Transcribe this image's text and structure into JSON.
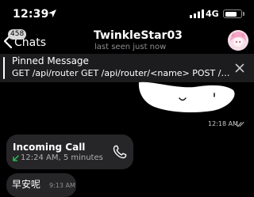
{
  "status_bar": {
    "time": "12:39",
    "network": "4G",
    "icons": [
      "location-arrow-icon",
      "cellular-signal-icon",
      "battery-icon"
    ]
  },
  "header": {
    "back_label": "Chats",
    "unread_badge": "458",
    "title": "TwinkleStar03",
    "subtitle": "last seen just now"
  },
  "pinned": {
    "title": "Pinned Message",
    "text": "GET /api/router GET /api/router/<name> POST /api/r..."
  },
  "messages": {
    "sticker_time": "12:18 AM",
    "call": {
      "title": "Incoming Call",
      "detail": "12:24 AM, 5 minutes"
    },
    "last": {
      "text": "早安呢",
      "time": "9:13 AM"
    }
  },
  "colors": {
    "background": "#000000",
    "bubble": "#262628",
    "pinned_bg": "#1c1c1e",
    "call_arrow": "#34c759",
    "muted_text": "#8e8e93"
  }
}
